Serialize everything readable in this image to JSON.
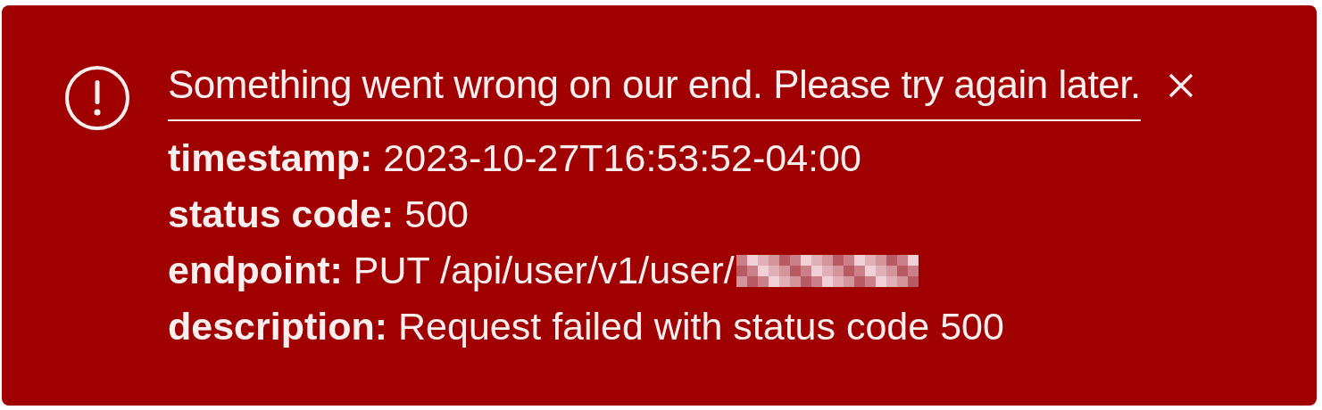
{
  "alert": {
    "message": "Something went wrong on our end. Please try again later.",
    "details": [
      {
        "text": "**timestamp:** 2023-10-27T16:53:52-04:00",
        "redacted": false
      },
      {
        "text": "**status code:** 500",
        "redacted": false
      },
      {
        "text": "**endpoint:** PUT /api/user/v1/user/",
        "redacted": true
      },
      {
        "text": "**description:** Request failed with status code 500",
        "redacted": false
      }
    ]
  }
}
